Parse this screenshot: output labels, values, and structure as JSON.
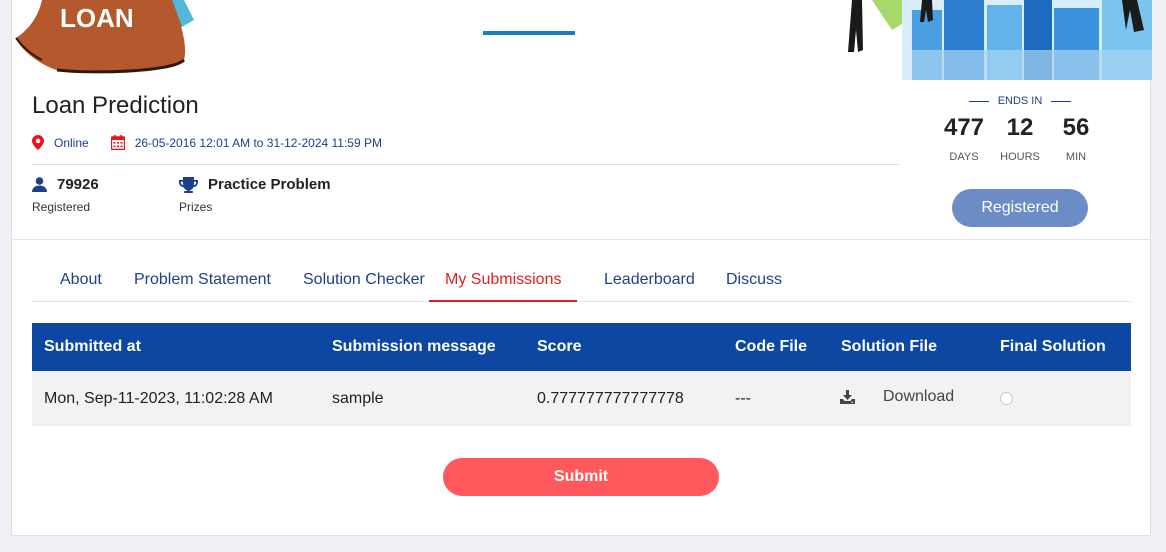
{
  "banner": {
    "logo_text": "LOAN"
  },
  "contest": {
    "title": "Loan Prediction",
    "location": "Online",
    "dates": "26-05-2016 12:01 AM to 31-12-2024 11:59 PM",
    "registered_count": "79926",
    "registered_label": "Registered",
    "prize": "Practice Problem",
    "prize_label": "Prizes"
  },
  "countdown": {
    "heading": "ENDS IN",
    "days": "477",
    "days_label": "DAYS",
    "hours": "12",
    "hours_label": "HOURS",
    "minutes": "56",
    "minutes_label": "MIN",
    "status_button": "Registered"
  },
  "tabs": [
    {
      "label": "About"
    },
    {
      "label": "Problem Statement"
    },
    {
      "label": "Solution Checker"
    },
    {
      "label": "My Submissions",
      "active": true
    },
    {
      "label": "Leaderboard"
    },
    {
      "label": "Discuss"
    }
  ],
  "table": {
    "headers": [
      "Submitted at",
      "Submission message",
      "Score",
      "Code File",
      "Solution File",
      "Final Solution"
    ],
    "rows": [
      {
        "submitted_at": "Mon, Sep-11-2023, 11:02:28 AM",
        "message": "sample",
        "score": "0.777777777777778",
        "code_file": "---",
        "solution_file": "Download",
        "final_solution_selected": false
      }
    ]
  },
  "actions": {
    "submit_label": "Submit"
  },
  "colors": {
    "primary_blue": "#0d47a1",
    "link_blue": "#1e3f8c",
    "active_tab": "#e02020",
    "submit_button": "#ff585d",
    "registered_button": "#6c8cc6"
  },
  "icons": {
    "location": "location-pin-icon",
    "calendar": "calendar-icon",
    "registered": "user-icon",
    "prize": "trophy-icon",
    "download": "download-icon"
  }
}
